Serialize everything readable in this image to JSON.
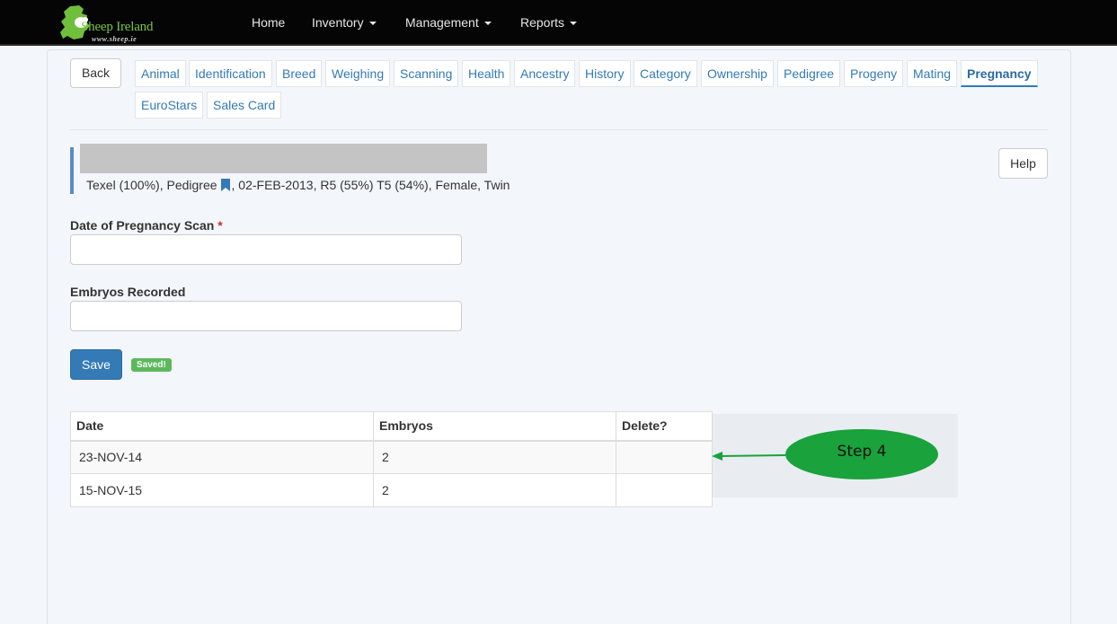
{
  "brand": {
    "name": "Sheep Ireland",
    "url": "www.sheep.ie"
  },
  "nav": {
    "home": "Home",
    "inventory": "Inventory",
    "management": "Management",
    "reports": "Reports"
  },
  "back_label": "Back",
  "help_label": "Help",
  "tabs": [
    "Animal",
    "Identification",
    "Breed",
    "Weighing",
    "Scanning",
    "Health",
    "Ancestry",
    "History",
    "Category",
    "Ownership",
    "Pedigree",
    "Progeny",
    "Mating",
    "Pregnancy",
    "EuroStars",
    "Sales Card"
  ],
  "active_tab": "Pregnancy",
  "animal": {
    "info_before": "Texel (100%), Pedigree",
    "info_after": ", 02-FEB-2013, R5 (55%) T5 (54%), Female, Twin"
  },
  "form": {
    "scan_date_label": "Date of Pregnancy Scan",
    "required_marker": "*",
    "scan_date_value": "",
    "embryos_label": "Embryos Recorded",
    "embryos_value": "",
    "save_label": "Save",
    "saved_badge": "Saved!"
  },
  "table": {
    "headers": {
      "date": "Date",
      "embryos": "Embryos",
      "delete": "Delete?"
    },
    "rows": [
      {
        "date": "23-NOV-14",
        "embryos": "2",
        "delete": ""
      },
      {
        "date": "15-NOV-15",
        "embryos": "2",
        "delete": ""
      }
    ]
  },
  "annotation": {
    "label": "Step 4"
  },
  "colors": {
    "navbar": "#050505",
    "link": "#337ab7",
    "primary": "#337ab7",
    "success": "#5cb85c",
    "annotation": "#1aa23c"
  }
}
